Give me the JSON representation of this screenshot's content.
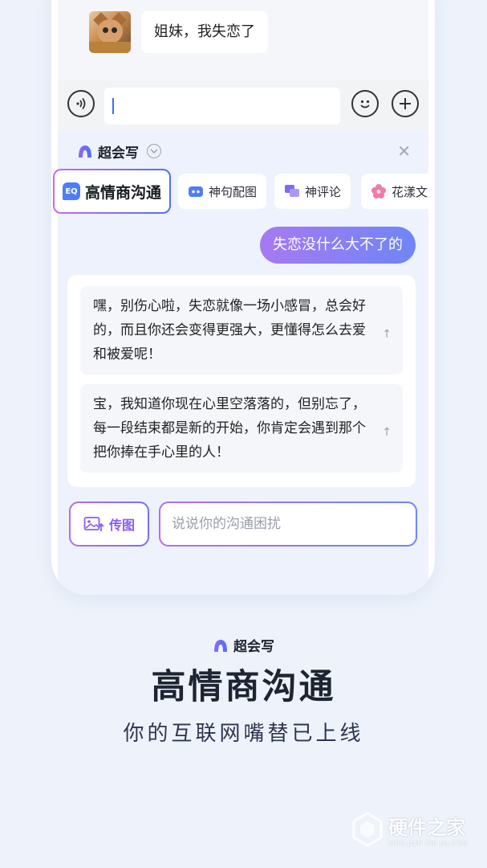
{
  "chat": {
    "incoming_message": "姐妹，我失恋了"
  },
  "assistant": {
    "brand": "超会写",
    "chips": [
      {
        "label": "高情商沟通",
        "icon": "eq-icon",
        "icon_text": "EQ"
      },
      {
        "label": "神句配图",
        "icon": "robot-icon"
      },
      {
        "label": "神评论",
        "icon": "comment-icon"
      },
      {
        "label": "花漾文",
        "icon": "flower-icon"
      }
    ],
    "user_prompt": "失恋没什么大不了的",
    "replies": [
      "嘿，别伤心啦，失恋就像一场小感冒，总会好的，而且你还会变得更强大，更懂得怎么去爱和被爱呢！",
      "宝，我知道你现在心里空落落的，但别忘了，每一段结束都是新的开始，你肯定会遇到那个把你捧在手心里的人！"
    ],
    "upload_label": "传图",
    "input_placeholder": "说说你的沟通困扰"
  },
  "promo": {
    "brand": "超会写",
    "title": "高情商沟通",
    "subtitle": "你的互联网嘴替已上线"
  },
  "watermark": {
    "main": "硬件之家",
    "sub": "YING JIAN ZHI JIA.COM"
  },
  "colors": {
    "accent_purple": "#a779f2",
    "accent_blue": "#4f6ef7",
    "background": "#eef3fb"
  }
}
